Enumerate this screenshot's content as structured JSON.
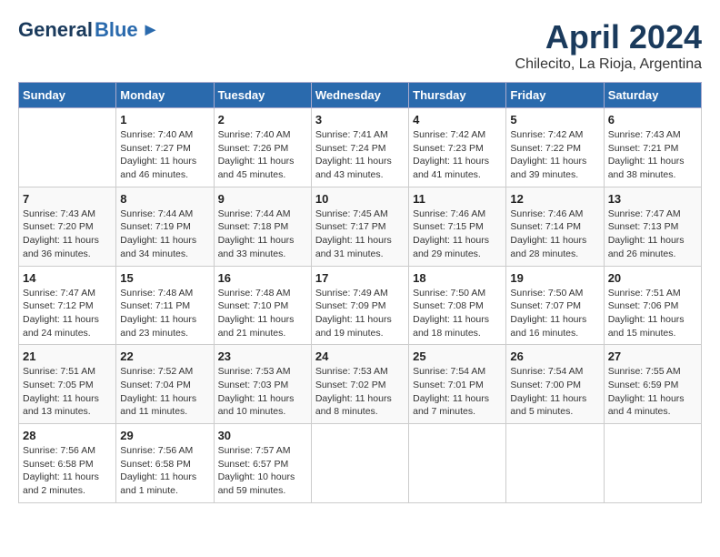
{
  "header": {
    "logo_general": "General",
    "logo_blue": "Blue",
    "month_title": "April 2024",
    "subtitle": "Chilecito, La Rioja, Argentina"
  },
  "days_of_week": [
    "Sunday",
    "Monday",
    "Tuesday",
    "Wednesday",
    "Thursday",
    "Friday",
    "Saturday"
  ],
  "weeks": [
    [
      {
        "day": "",
        "sunrise": "",
        "sunset": "",
        "daylight": ""
      },
      {
        "day": "1",
        "sunrise": "Sunrise: 7:40 AM",
        "sunset": "Sunset: 7:27 PM",
        "daylight": "Daylight: 11 hours and 46 minutes."
      },
      {
        "day": "2",
        "sunrise": "Sunrise: 7:40 AM",
        "sunset": "Sunset: 7:26 PM",
        "daylight": "Daylight: 11 hours and 45 minutes."
      },
      {
        "day": "3",
        "sunrise": "Sunrise: 7:41 AM",
        "sunset": "Sunset: 7:24 PM",
        "daylight": "Daylight: 11 hours and 43 minutes."
      },
      {
        "day": "4",
        "sunrise": "Sunrise: 7:42 AM",
        "sunset": "Sunset: 7:23 PM",
        "daylight": "Daylight: 11 hours and 41 minutes."
      },
      {
        "day": "5",
        "sunrise": "Sunrise: 7:42 AM",
        "sunset": "Sunset: 7:22 PM",
        "daylight": "Daylight: 11 hours and 39 minutes."
      },
      {
        "day": "6",
        "sunrise": "Sunrise: 7:43 AM",
        "sunset": "Sunset: 7:21 PM",
        "daylight": "Daylight: 11 hours and 38 minutes."
      }
    ],
    [
      {
        "day": "7",
        "sunrise": "Sunrise: 7:43 AM",
        "sunset": "Sunset: 7:20 PM",
        "daylight": "Daylight: 11 hours and 36 minutes."
      },
      {
        "day": "8",
        "sunrise": "Sunrise: 7:44 AM",
        "sunset": "Sunset: 7:19 PM",
        "daylight": "Daylight: 11 hours and 34 minutes."
      },
      {
        "day": "9",
        "sunrise": "Sunrise: 7:44 AM",
        "sunset": "Sunset: 7:18 PM",
        "daylight": "Daylight: 11 hours and 33 minutes."
      },
      {
        "day": "10",
        "sunrise": "Sunrise: 7:45 AM",
        "sunset": "Sunset: 7:17 PM",
        "daylight": "Daylight: 11 hours and 31 minutes."
      },
      {
        "day": "11",
        "sunrise": "Sunrise: 7:46 AM",
        "sunset": "Sunset: 7:15 PM",
        "daylight": "Daylight: 11 hours and 29 minutes."
      },
      {
        "day": "12",
        "sunrise": "Sunrise: 7:46 AM",
        "sunset": "Sunset: 7:14 PM",
        "daylight": "Daylight: 11 hours and 28 minutes."
      },
      {
        "day": "13",
        "sunrise": "Sunrise: 7:47 AM",
        "sunset": "Sunset: 7:13 PM",
        "daylight": "Daylight: 11 hours and 26 minutes."
      }
    ],
    [
      {
        "day": "14",
        "sunrise": "Sunrise: 7:47 AM",
        "sunset": "Sunset: 7:12 PM",
        "daylight": "Daylight: 11 hours and 24 minutes."
      },
      {
        "day": "15",
        "sunrise": "Sunrise: 7:48 AM",
        "sunset": "Sunset: 7:11 PM",
        "daylight": "Daylight: 11 hours and 23 minutes."
      },
      {
        "day": "16",
        "sunrise": "Sunrise: 7:48 AM",
        "sunset": "Sunset: 7:10 PM",
        "daylight": "Daylight: 11 hours and 21 minutes."
      },
      {
        "day": "17",
        "sunrise": "Sunrise: 7:49 AM",
        "sunset": "Sunset: 7:09 PM",
        "daylight": "Daylight: 11 hours and 19 minutes."
      },
      {
        "day": "18",
        "sunrise": "Sunrise: 7:50 AM",
        "sunset": "Sunset: 7:08 PM",
        "daylight": "Daylight: 11 hours and 18 minutes."
      },
      {
        "day": "19",
        "sunrise": "Sunrise: 7:50 AM",
        "sunset": "Sunset: 7:07 PM",
        "daylight": "Daylight: 11 hours and 16 minutes."
      },
      {
        "day": "20",
        "sunrise": "Sunrise: 7:51 AM",
        "sunset": "Sunset: 7:06 PM",
        "daylight": "Daylight: 11 hours and 15 minutes."
      }
    ],
    [
      {
        "day": "21",
        "sunrise": "Sunrise: 7:51 AM",
        "sunset": "Sunset: 7:05 PM",
        "daylight": "Daylight: 11 hours and 13 minutes."
      },
      {
        "day": "22",
        "sunrise": "Sunrise: 7:52 AM",
        "sunset": "Sunset: 7:04 PM",
        "daylight": "Daylight: 11 hours and 11 minutes."
      },
      {
        "day": "23",
        "sunrise": "Sunrise: 7:53 AM",
        "sunset": "Sunset: 7:03 PM",
        "daylight": "Daylight: 11 hours and 10 minutes."
      },
      {
        "day": "24",
        "sunrise": "Sunrise: 7:53 AM",
        "sunset": "Sunset: 7:02 PM",
        "daylight": "Daylight: 11 hours and 8 minutes."
      },
      {
        "day": "25",
        "sunrise": "Sunrise: 7:54 AM",
        "sunset": "Sunset: 7:01 PM",
        "daylight": "Daylight: 11 hours and 7 minutes."
      },
      {
        "day": "26",
        "sunrise": "Sunrise: 7:54 AM",
        "sunset": "Sunset: 7:00 PM",
        "daylight": "Daylight: 11 hours and 5 minutes."
      },
      {
        "day": "27",
        "sunrise": "Sunrise: 7:55 AM",
        "sunset": "Sunset: 6:59 PM",
        "daylight": "Daylight: 11 hours and 4 minutes."
      }
    ],
    [
      {
        "day": "28",
        "sunrise": "Sunrise: 7:56 AM",
        "sunset": "Sunset: 6:58 PM",
        "daylight": "Daylight: 11 hours and 2 minutes."
      },
      {
        "day": "29",
        "sunrise": "Sunrise: 7:56 AM",
        "sunset": "Sunset: 6:58 PM",
        "daylight": "Daylight: 11 hours and 1 minute."
      },
      {
        "day": "30",
        "sunrise": "Sunrise: 7:57 AM",
        "sunset": "Sunset: 6:57 PM",
        "daylight": "Daylight: 10 hours and 59 minutes."
      },
      {
        "day": "",
        "sunrise": "",
        "sunset": "",
        "daylight": ""
      },
      {
        "day": "",
        "sunrise": "",
        "sunset": "",
        "daylight": ""
      },
      {
        "day": "",
        "sunrise": "",
        "sunset": "",
        "daylight": ""
      },
      {
        "day": "",
        "sunrise": "",
        "sunset": "",
        "daylight": ""
      }
    ]
  ]
}
